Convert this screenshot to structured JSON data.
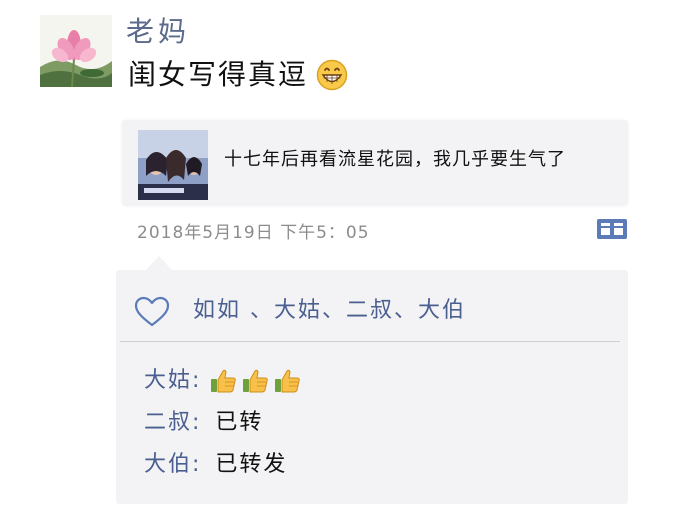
{
  "post": {
    "author": "老妈",
    "text": "闺女写得真逗",
    "text_emoji": "grinning-face-icon"
  },
  "link": {
    "title": "十七年后再看流星花园，我几乎要生气了"
  },
  "timestamp": "2018年5月19日 下午5：05",
  "likes": {
    "names": "如如 、大姑、二叔、大伯"
  },
  "comments": [
    {
      "author": "大姑:",
      "text": "",
      "emojis": [
        "thumbs-up-icon",
        "thumbs-up-icon",
        "thumbs-up-icon"
      ]
    },
    {
      "author": "二叔:",
      "text": "已转",
      "emojis": []
    },
    {
      "author": "大伯:",
      "text": "已转发",
      "emojis": []
    }
  ],
  "colors": {
    "name_blue": "#5b6b8c",
    "link_blue": "#4a5f8f",
    "panel_bg": "#f3f3f5",
    "timestamp_gray": "#8c8c8c"
  }
}
